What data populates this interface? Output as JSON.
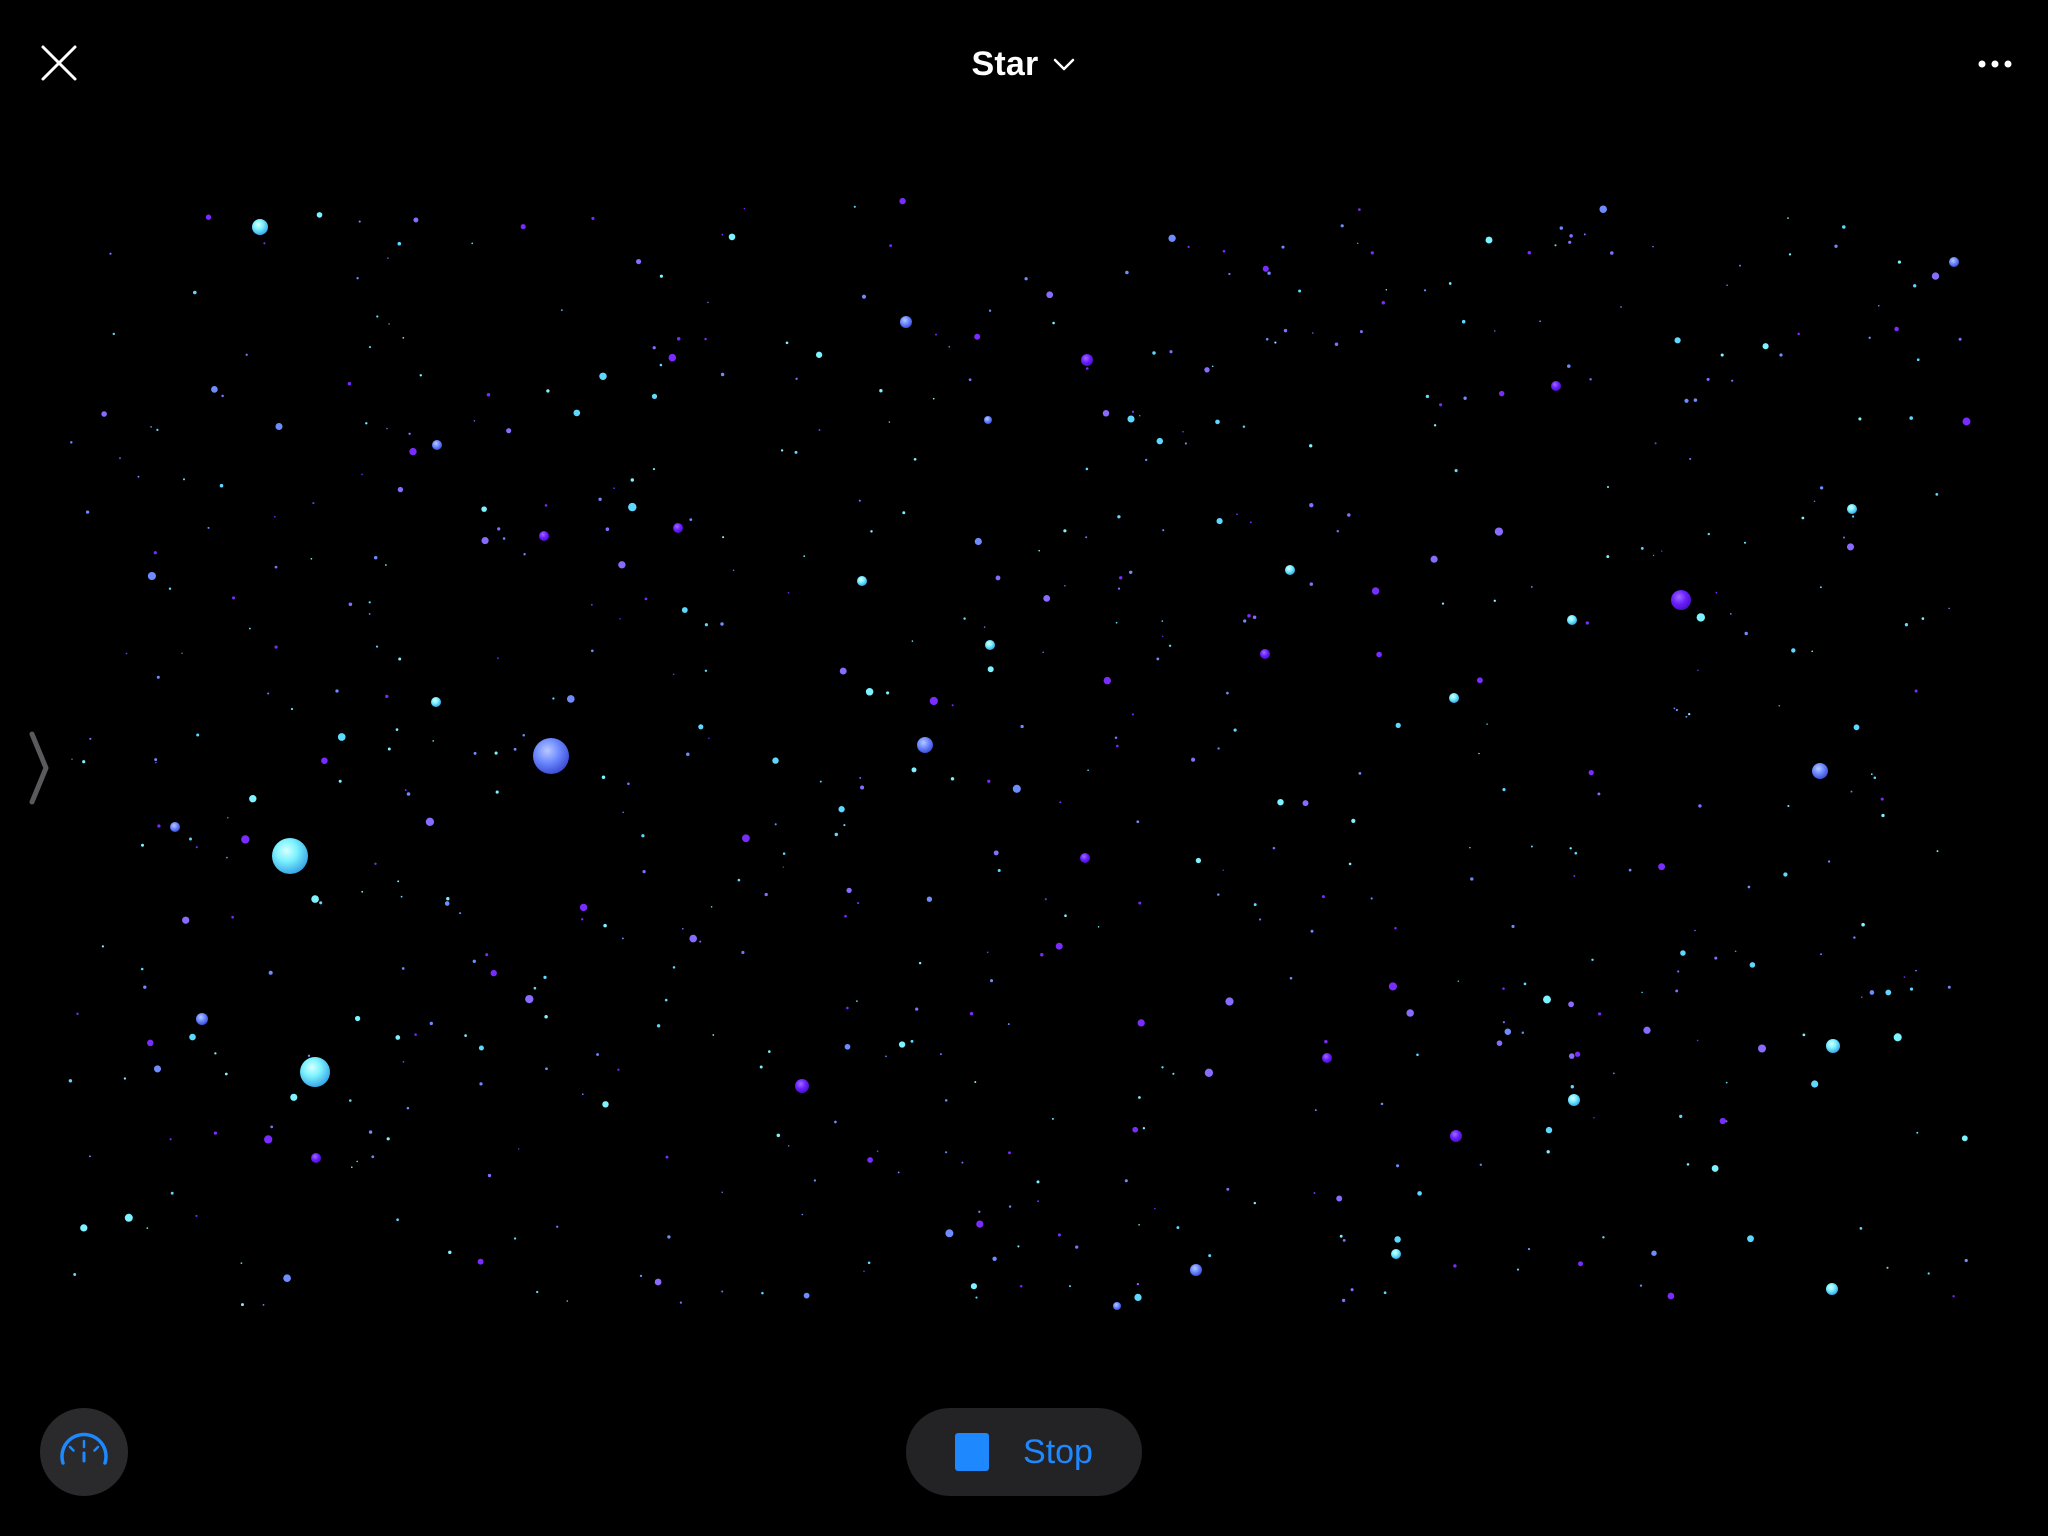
{
  "header": {
    "title": "Star",
    "close_icon": "close-icon",
    "chevron_icon": "chevron-down-icon",
    "more_icon": "more-icon"
  },
  "controls": {
    "stop_label": "Stop",
    "stop_icon": "stop-square-icon",
    "speed_icon": "speedometer-icon",
    "side_handle_icon": "chevron-right-icon"
  },
  "colors": {
    "background": "#000000",
    "accent": "#1e88ff",
    "star_cyan": "#7df3ff",
    "star_blue": "#6f8cff",
    "star_violet": "#7a2cff"
  }
}
